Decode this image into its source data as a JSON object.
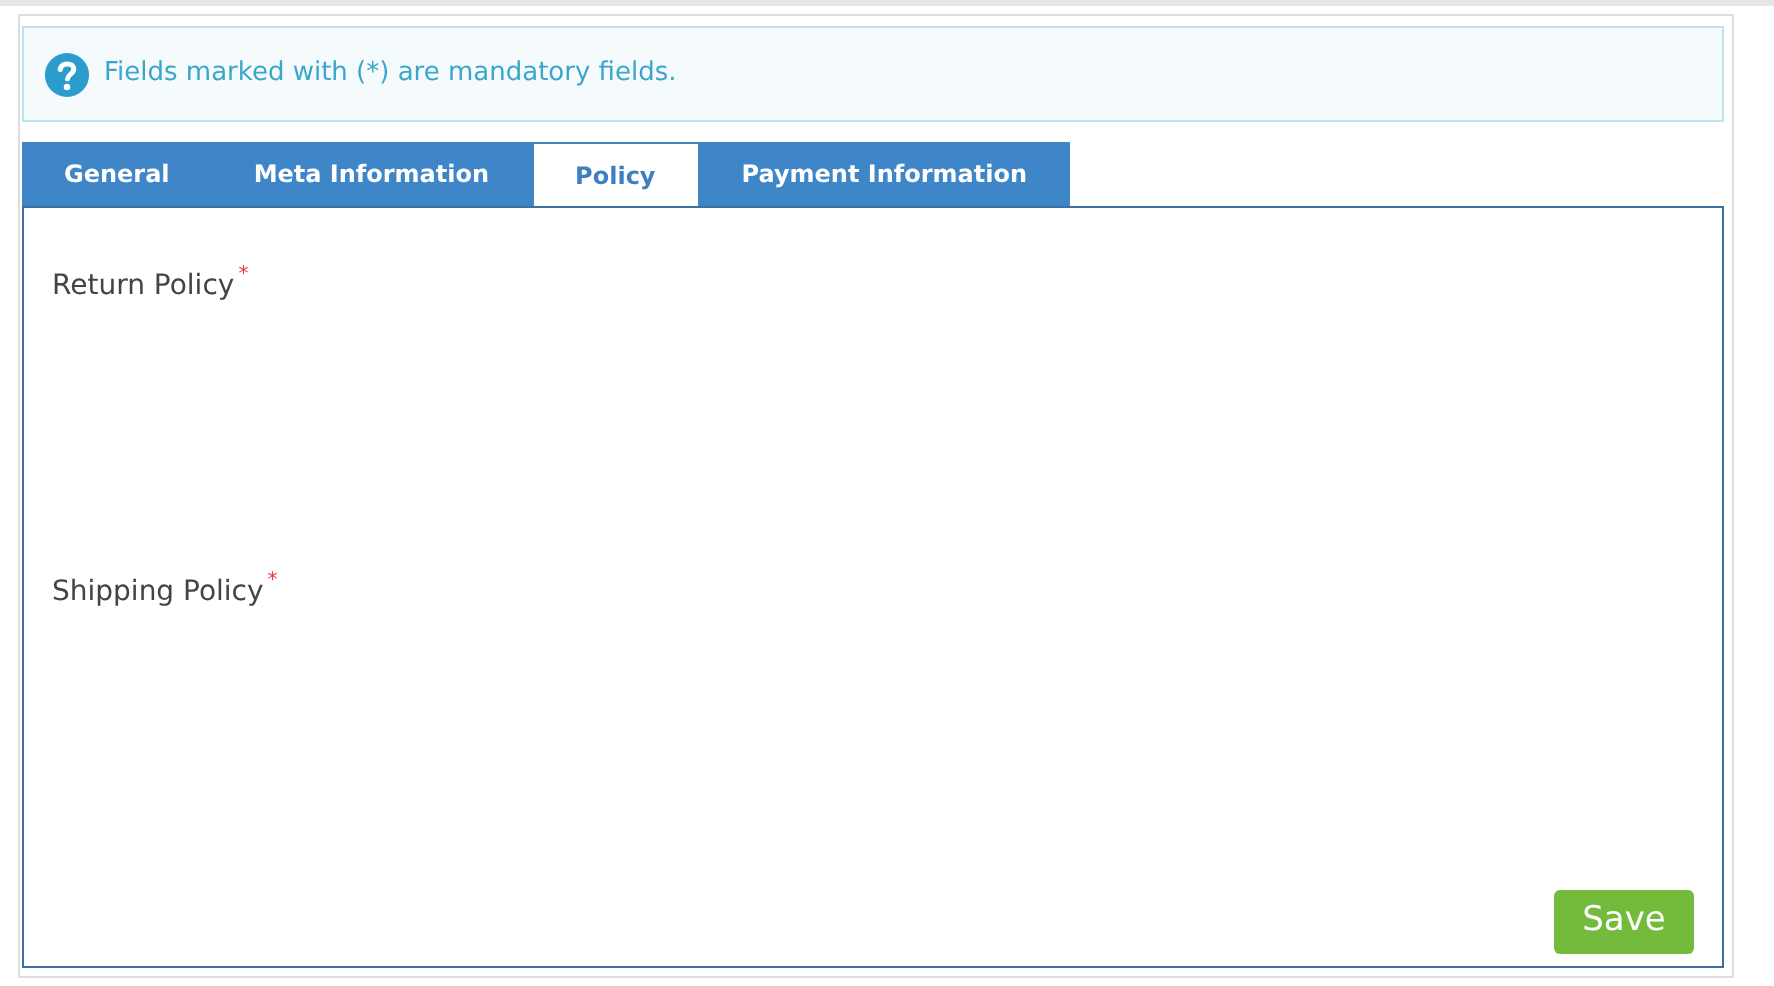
{
  "notice": {
    "text": "Fields marked with (*) are mandatory fields."
  },
  "tabs": [
    {
      "label": "General",
      "selected": false
    },
    {
      "label": "Meta Information",
      "selected": false
    },
    {
      "label": "Policy",
      "selected": true
    },
    {
      "label": "Payment Information",
      "selected": false
    }
  ],
  "fields": [
    {
      "label": "Return Policy",
      "required_mark": "*"
    },
    {
      "label": "Shipping Policy",
      "required_mark": "*"
    }
  ],
  "save_button": "Save"
}
